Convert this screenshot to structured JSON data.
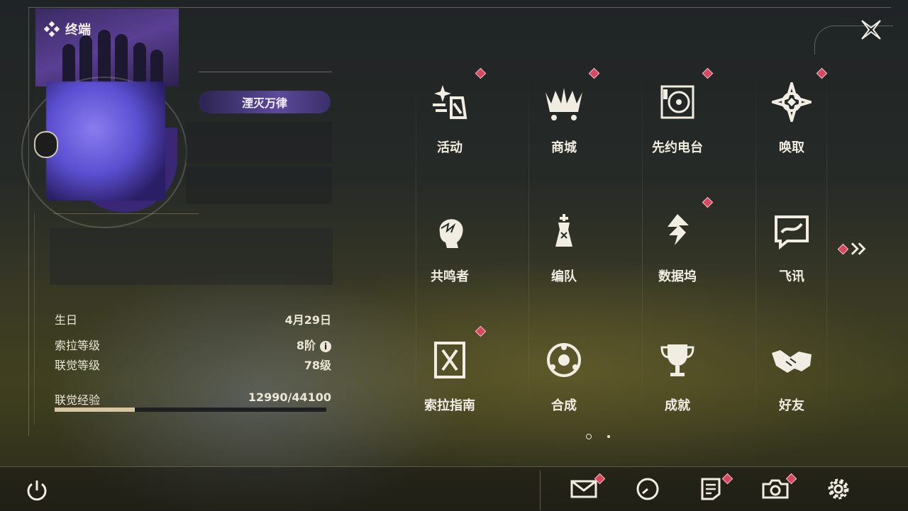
{
  "header": {
    "title": "终端",
    "title_badge": "湮灭万律"
  },
  "profile": {
    "rows": [
      {
        "label": "生日",
        "value": "4月29日"
      },
      {
        "label": "索拉等级",
        "value": "8阶"
      },
      {
        "label": "联觉等级",
        "value": "78级"
      },
      {
        "label": "联觉经验",
        "value": "12990/44100"
      }
    ],
    "exp_current": 12990,
    "exp_max": 44100,
    "info_glyph": "i"
  },
  "menu": [
    {
      "label": "活动",
      "icon": "activity-icon",
      "badge": true
    },
    {
      "label": "商城",
      "icon": "shop-cart-icon",
      "badge": true
    },
    {
      "label": "先约电台",
      "icon": "radio-icon",
      "badge": true
    },
    {
      "label": "唤取",
      "icon": "summon-compass-icon",
      "badge": true
    },
    {
      "label": "共鸣者",
      "icon": "resonator-head-icon",
      "badge": false
    },
    {
      "label": "编队",
      "icon": "team-chess-icon",
      "badge": false
    },
    {
      "label": "数据坞",
      "icon": "databank-icon",
      "badge": true
    },
    {
      "label": "飞讯",
      "icon": "message-icon",
      "badge": false
    },
    {
      "label": "索拉指南",
      "icon": "guide-book-icon",
      "badge": true
    },
    {
      "label": "合成",
      "icon": "synthesis-icon",
      "badge": false
    },
    {
      "label": "成就",
      "icon": "trophy-icon",
      "badge": false
    },
    {
      "label": "好友",
      "icon": "handshake-icon",
      "badge": false
    }
  ],
  "pager": {
    "pages": 2,
    "current": 1
  },
  "toolbar": [
    {
      "name": "mail-icon",
      "badge": true
    },
    {
      "name": "clock-icon",
      "badge": false
    },
    {
      "name": "notice-icon",
      "badge": true
    },
    {
      "name": "camera-icon",
      "badge": true
    },
    {
      "name": "settings-gear-icon",
      "badge": false
    }
  ],
  "colors": {
    "badge": "#d8475b",
    "accent": "#d7c7a0",
    "text": "#f2ede3"
  }
}
